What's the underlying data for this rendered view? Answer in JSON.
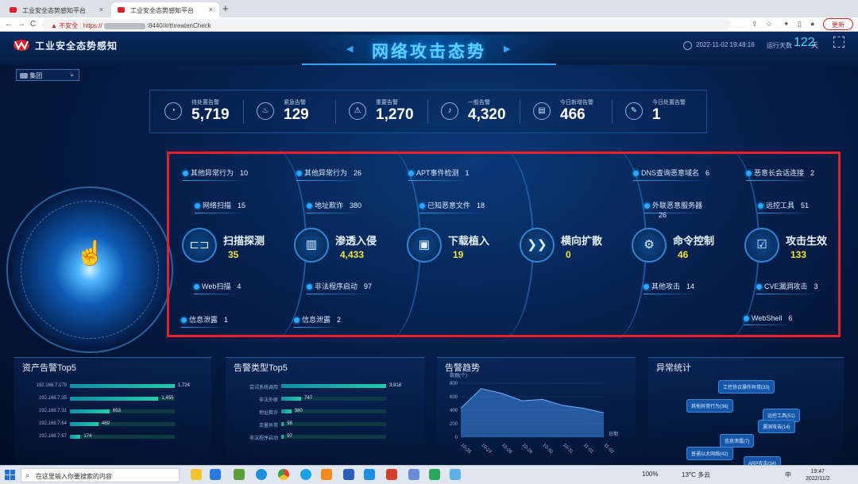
{
  "browser": {
    "tabs": [
      {
        "label": "工业安全态势感知平台"
      },
      {
        "label": "工业安全态势感知平台"
      }
    ],
    "new_tab": "+",
    "nav": {
      "back": "←",
      "forward": "→",
      "reload": "C"
    },
    "url": {
      "insecure_label": "不安全",
      "scheme": "https://",
      "port_path": ":8440/#/threatenCheck"
    },
    "update_label": "更新"
  },
  "header": {
    "brand": "工业安全态势感知",
    "title": "网络攻击态势",
    "prev_arrow": "◀",
    "next_arrow": "▶",
    "datetime": "2022-11-02 19:48:16",
    "uptime_label": "运行天数",
    "uptime_value": "122",
    "uptime_unit": "天"
  },
  "group_select": {
    "value": "集团",
    "chevron": "⌄"
  },
  "stats": [
    {
      "label": "待处置告警",
      "value": "5,719",
      "icon": "clock-icon",
      "glyph": "◔"
    },
    {
      "label": "紧急告警",
      "value": "129",
      "icon": "siren-icon",
      "glyph": "♨"
    },
    {
      "label": "重要告警",
      "value": "1,270",
      "icon": "warning-icon",
      "glyph": "⚠"
    },
    {
      "label": "一般告警",
      "value": "4,320",
      "icon": "bell-icon",
      "glyph": "♪"
    },
    {
      "label": "今日新增告警",
      "value": "466",
      "icon": "calendar-icon",
      "glyph": "▤"
    },
    {
      "label": "今日处置告警",
      "value": "1",
      "icon": "document-icon",
      "glyph": "✎"
    }
  ],
  "stages": [
    {
      "name": "扫描探测",
      "value": "35",
      "icon": "scan-icon",
      "glyph": "⊏⊐"
    },
    {
      "name": "渗透入侵",
      "value": "4,433",
      "icon": "intrusion-icon",
      "glyph": "▥"
    },
    {
      "name": "下载植入",
      "value": "19",
      "icon": "chip-icon",
      "glyph": "▣"
    },
    {
      "name": "横向扩散",
      "value": "0",
      "icon": "spread-icon",
      "glyph": "❯❯"
    },
    {
      "name": "命令控制",
      "value": "46",
      "icon": "command-icon",
      "glyph": "⚙"
    },
    {
      "name": "攻击生效",
      "value": "133",
      "icon": "effect-icon",
      "glyph": "☑"
    }
  ],
  "attack_items": {
    "scan": [
      {
        "label": "其他异常行为",
        "count": "10"
      },
      {
        "label": "网络扫描",
        "count": "15"
      },
      {
        "label": "Web扫描",
        "count": "4"
      },
      {
        "label": "信息泄露",
        "count": "1"
      }
    ],
    "intrusion": [
      {
        "label": "其他异常行为",
        "count": "26"
      },
      {
        "label": "地址欺诈",
        "count": "380"
      },
      {
        "label": "非法程序启动",
        "count": "97"
      },
      {
        "label": "信息泄露",
        "count": "2"
      }
    ],
    "download": [
      {
        "label": "APT事件检测",
        "count": "1"
      },
      {
        "label": "已知恶意文件",
        "count": "18"
      }
    ],
    "command": [
      {
        "label": "DNS查询恶意域名",
        "count": "6"
      },
      {
        "label": "外联恶意服务器",
        "count": "26"
      },
      {
        "label": "其他攻击",
        "count": "14"
      }
    ],
    "effect": [
      {
        "label": "恶意长会话连接",
        "count": "2"
      },
      {
        "label": "远控工具",
        "count": "51"
      },
      {
        "label": "CVE漏洞攻击",
        "count": "3"
      },
      {
        "label": "WebShell",
        "count": "6"
      }
    ]
  },
  "asset_top5": {
    "title": "资产告警Top5",
    "rows": [
      {
        "ip": "192.168.7.179",
        "value": 1724,
        "label": "1,724"
      },
      {
        "ip": "192.168.7.35",
        "value": 1455,
        "label": "1,455"
      },
      {
        "ip": "192.168.7.31",
        "value": 653,
        "label": "653"
      },
      {
        "ip": "192.168.7.64",
        "value": 469,
        "label": "469"
      },
      {
        "ip": "192.168.7.57",
        "value": 174,
        "label": "174"
      }
    ],
    "max": 1724
  },
  "type_top5": {
    "title": "告警类型Top5",
    "rows": [
      {
        "name": "尝试系统调用",
        "value": 3918,
        "label": "3,918"
      },
      {
        "name": "非法外联",
        "value": 747,
        "label": "747"
      },
      {
        "name": "地址欺诈",
        "value": 380,
        "label": "380"
      },
      {
        "name": "流量异常",
        "value": 98,
        "label": "98"
      },
      {
        "name": "非法程序启动",
        "value": 97,
        "label": "97"
      }
    ],
    "max": 3918
  },
  "trend": {
    "title": "告警趋势",
    "y_unit": "数据(个)",
    "x_label": "日期",
    "y_ticks": [
      "800",
      "600",
      "400",
      "200",
      "0"
    ],
    "x_ticks": [
      "10-26",
      "10-27",
      "10-28",
      "10-29",
      "10-30",
      "10-31",
      "11-01",
      "11-02"
    ]
  },
  "chart_data": {
    "type": "area",
    "title": "告警趋势",
    "xlabel": "日期",
    "ylabel": "数据(个)",
    "ylim": [
      0,
      800
    ],
    "x": [
      "10-26",
      "10-27",
      "10-28",
      "10-29",
      "10-30",
      "10-31",
      "11-01",
      "11-02"
    ],
    "values": [
      430,
      720,
      650,
      540,
      560,
      470,
      430,
      360
    ]
  },
  "anomaly": {
    "title": "异常统计",
    "bubbles": [
      {
        "label": "工控协议操作异常(33)"
      },
      {
        "label": "其他异常行为(36)"
      },
      {
        "label": "远控工具(51)"
      },
      {
        "label": "漏洞攻击(14)"
      },
      {
        "label": "信息泄露(7)"
      },
      {
        "label": "普通以太网络(42)"
      },
      {
        "label": "ARP攻击(34)"
      }
    ]
  },
  "taskbar": {
    "search_placeholder": "在这里输入你要搜索的内容",
    "weather": "13°C 多云",
    "ime": "中",
    "battery": "100%",
    "time": "19:47",
    "date": "2022/11/2"
  }
}
